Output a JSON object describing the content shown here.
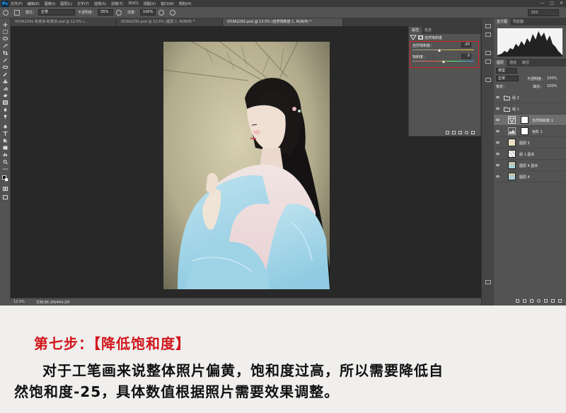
{
  "app": {
    "logo": "Ps",
    "menu": [
      "文件(F)",
      "编辑(E)",
      "图像(I)",
      "图层(L)",
      "文字(Y)",
      "选择(S)",
      "滤镜(T)",
      "3D(D)",
      "视图(V)",
      "窗口(W)",
      "帮助(H)"
    ],
    "window_controls": [
      "—",
      "□",
      "✕"
    ]
  },
  "options_bar": {
    "mode_label": "模式：",
    "mode_value": "正常",
    "opacity_label": "不透明度：",
    "opacity_value": "35%",
    "flow_label": "流量：",
    "flow_value": "100%",
    "search_value": "555"
  },
  "doc_tabs": [
    "0O3A2291-秋意浓-秋意浓.psd @ 12.5% (...",
    "0O3A2291.psd @ 12.5% (图层 1, RGB/8) *",
    "0O3A2291.psd @ 12.5% (自然饱和度 1, RGB/8) *"
  ],
  "status_bar": {
    "zoom": "12.5%",
    "doc_info": "文档:86.1M/444.2M"
  },
  "properties": {
    "tabs": [
      "属性",
      "信息"
    ],
    "title": "自然饱和度",
    "sliders": [
      {
        "label": "自然饱和度：",
        "value": "-25",
        "fraction": 0.4375
      },
      {
        "label": "饱和度：",
        "value": "0",
        "fraction": 0.5
      }
    ]
  },
  "histogram": {
    "tabs": [
      "直方图",
      "导航器"
    ]
  },
  "layers": {
    "tabs": [
      "图层",
      "通道",
      "路径"
    ],
    "filter_label": "类型",
    "blend_mode": "正常",
    "opacity_label": "不透明度：",
    "opacity_value": "100%",
    "lock_label": "锁定：",
    "fill_label": "填充：",
    "fill_value": "100%",
    "items": [
      {
        "name": "组 2"
      },
      {
        "name": "组 1"
      },
      {
        "name": "自然饱和度 1"
      },
      {
        "name": "色阶 1"
      },
      {
        "name": "图层 5"
      },
      {
        "name": "组 1 副本"
      },
      {
        "name": "图层 4 副本"
      },
      {
        "name": "图层 4"
      }
    ]
  },
  "colors": {
    "highlight": "#d1161c",
    "title_red": "#d1161c",
    "selected_layer": "#6e6e6e"
  },
  "caption": {
    "title": "第七步：【降低饱和度】",
    "line1": "对于工笔画来说整体照片偏黄，饱和度过高，所以需要降低自",
    "line2": "然饱和度-25，具体数值根据照片需要效果调整。"
  }
}
